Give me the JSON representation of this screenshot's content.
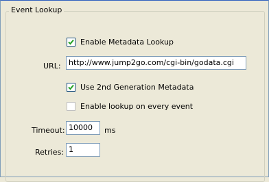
{
  "group": {
    "title": "Event Lookup"
  },
  "enable_metadata_lookup": {
    "label": "Enable Metadata Lookup",
    "checked": true
  },
  "url": {
    "label": "URL:",
    "value": "http://www.jump2go.com/cgi-bin/godata.cgi"
  },
  "use_2nd_gen_metadata": {
    "label": "Use 2nd Generation Metadata",
    "checked": true
  },
  "enable_lookup_every_event": {
    "label": "Enable lookup on every event",
    "checked": false
  },
  "timeout": {
    "label": "Timeout:",
    "value": "10000",
    "unit": "ms"
  },
  "retries": {
    "label": "Retries:",
    "value": "1"
  },
  "colors": {
    "checkbox_border": "#1c5180",
    "textbox_border": "#7f9db9",
    "panel_bg": "#ece9d8"
  }
}
